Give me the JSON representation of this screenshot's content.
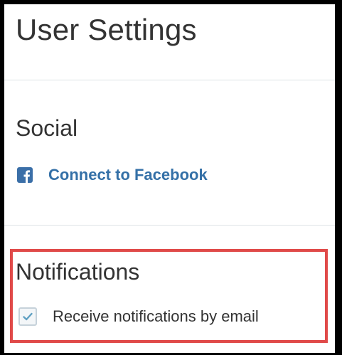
{
  "page": {
    "title": "User Settings"
  },
  "social": {
    "title": "Social",
    "facebook_link": "Connect to Facebook",
    "icon": "facebook-icon"
  },
  "notifications": {
    "title": "Notifications",
    "email_checkbox_label": "Receive notifications by email",
    "email_checkbox_checked": true,
    "icon": "checkmark-icon"
  },
  "colors": {
    "link": "#3470a7",
    "highlight": "#e04a49",
    "text": "#333333",
    "divider": "#dde3e6"
  }
}
